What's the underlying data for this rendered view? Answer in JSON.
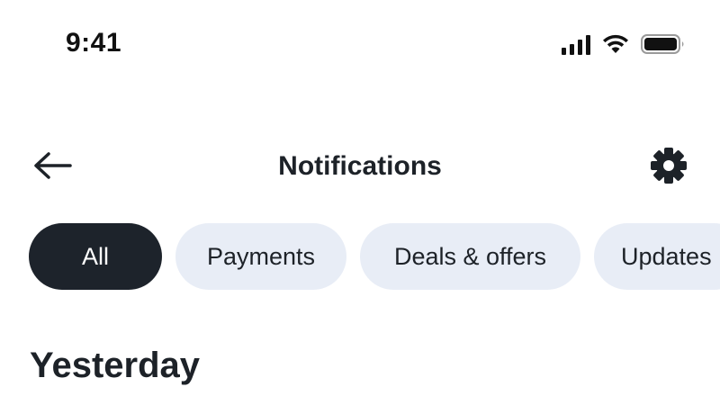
{
  "status_bar": {
    "time": "9:41",
    "icons": [
      "signal-icon",
      "wifi-icon",
      "battery-icon"
    ]
  },
  "nav": {
    "back_icon": "arrow-left-icon",
    "title": "Notifications",
    "settings_icon": "gear-icon"
  },
  "filters": {
    "selected": "All",
    "chips": [
      {
        "label": "All",
        "active": true
      },
      {
        "label": "Payments",
        "active": false
      },
      {
        "label": "Deals & offers",
        "active": false
      },
      {
        "label": "Updates",
        "active": false
      }
    ]
  },
  "sections": [
    {
      "header": "Yesterday"
    }
  ],
  "colors": {
    "active_chip_bg": "#1d232b",
    "chip_bg": "#e8edf6",
    "text": "#1d2228",
    "background": "#ffffff"
  }
}
